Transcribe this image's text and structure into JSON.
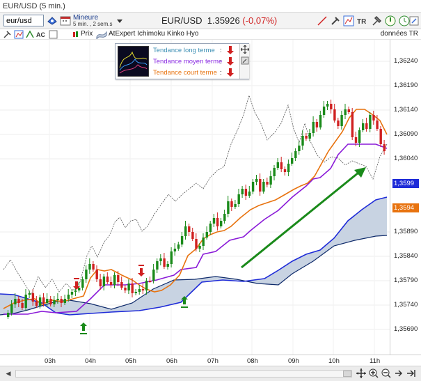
{
  "window": {
    "title": "EUR/USD (5 min.)"
  },
  "toolbar": {
    "symbol_value": "eur/usd",
    "period_main": "Mineure",
    "period_sub": "5 min. , 2 sem.s",
    "instrument": "EUR/USD",
    "price": "1.35926",
    "change": "(-0,07%)"
  },
  "legend": {
    "price_label": "Prix",
    "indicator_label": "AtExpert Ichimoku Kinko Hyo",
    "data_source": "données TR"
  },
  "trend_panel": {
    "rows": [
      {
        "label": "Tendance long terme",
        "colon": ":",
        "color": "#3c8fb4"
      },
      {
        "label": "Tendance moyen terme",
        "colon": ":",
        "color": "#8a2be2"
      },
      {
        "label": "Tendance court terme",
        "colon": ":",
        "color": "#e8730f"
      }
    ]
  },
  "chart_data": {
    "type": "candlestick",
    "yticks": [
      "1,36240",
      "1,36190",
      "1,36140",
      "1,36090",
      "1,36040",
      "1,35890",
      "1,35840",
      "1,35790",
      "1,35740",
      "1,35690"
    ],
    "xticks": [
      "03h",
      "04h",
      "05h",
      "06h",
      "07h",
      "08h",
      "09h",
      "10h",
      "11h"
    ],
    "price_tags": [
      {
        "label": "1,3599",
        "color": "#1e2bd8"
      },
      {
        "label": "1,3594",
        "color": "#e8730f"
      }
    ],
    "colors": {
      "up": "#1a8a1a",
      "down": "#d02020",
      "tenkan": "#e8730f",
      "kijun": "#8a1ad8",
      "chikou": "#555555",
      "senkou_a": "#1e2bd8",
      "senkou_b": "#0e2a6a",
      "cloud": "#c8d3e2",
      "arrow": "#1a8a1a"
    }
  }
}
